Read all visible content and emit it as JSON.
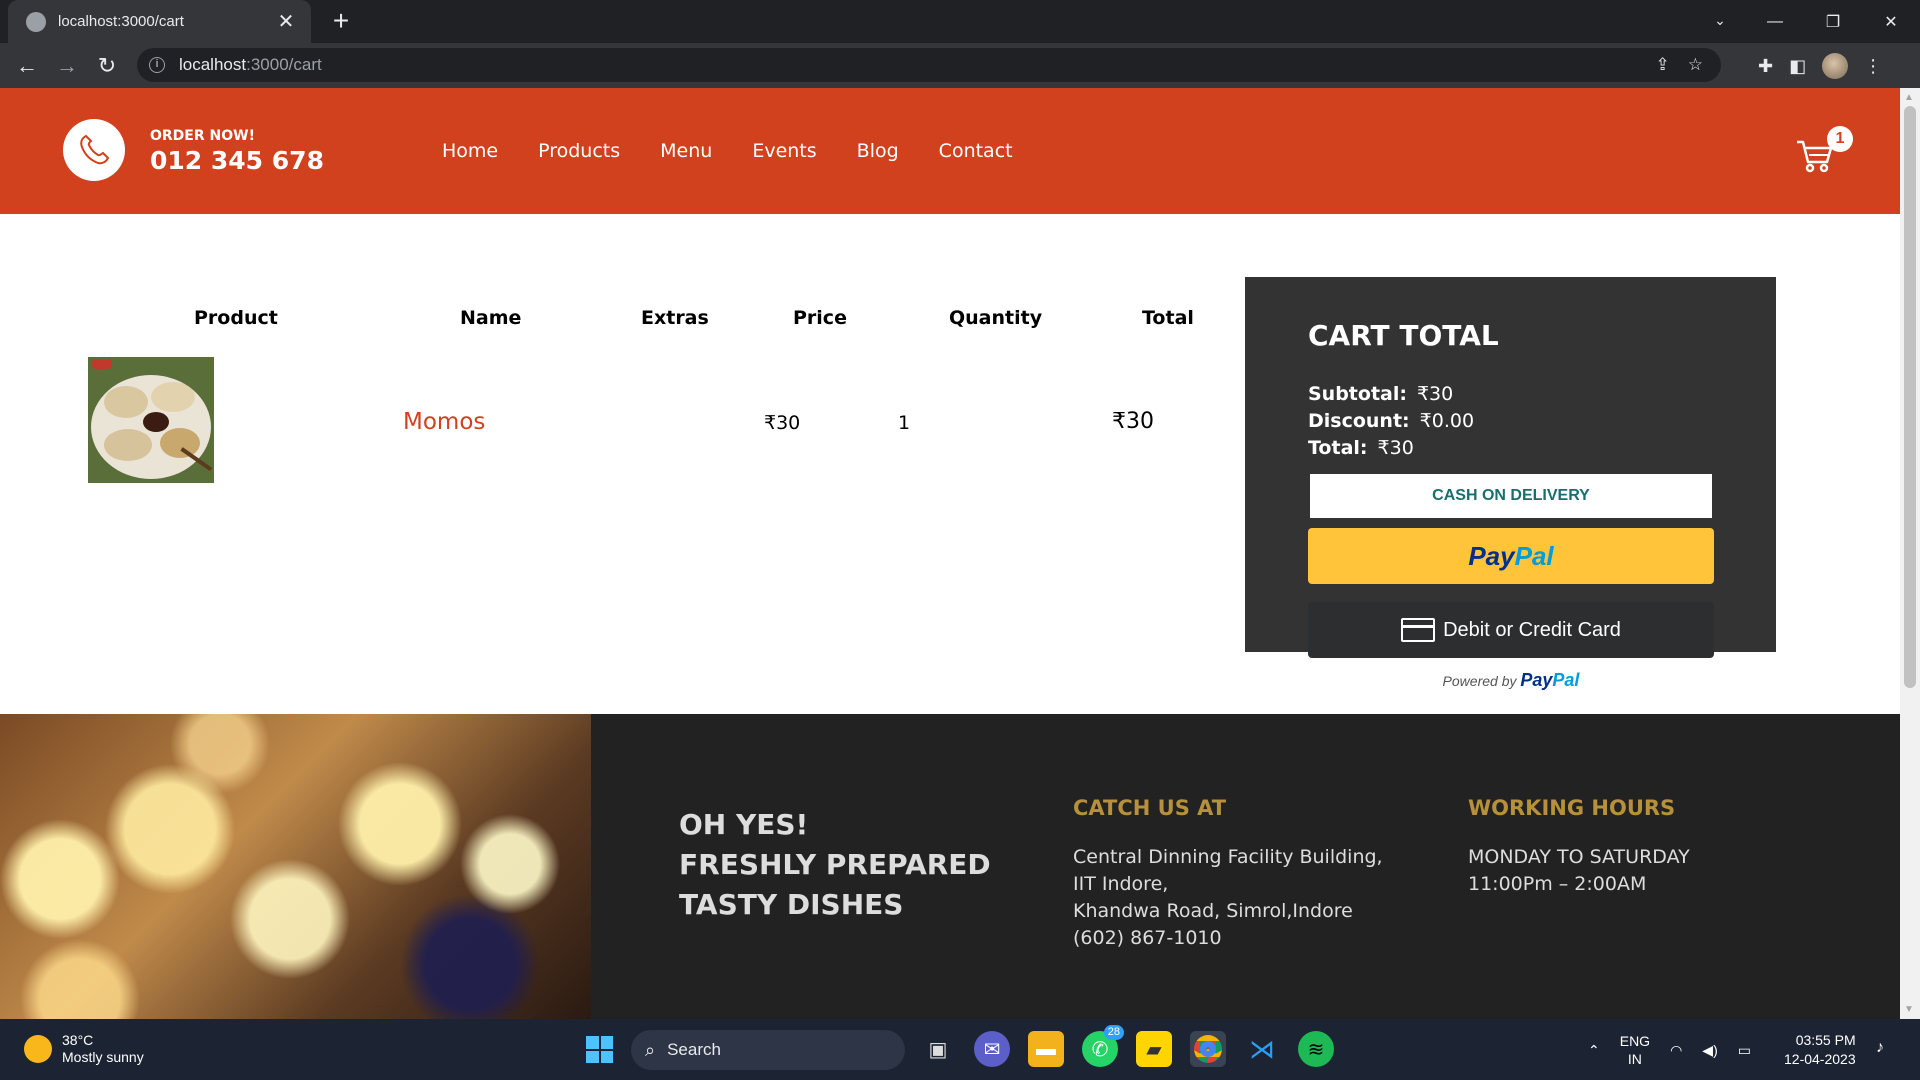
{
  "browser": {
    "tab_title": "localhost:3000/cart",
    "url_host": "localhost",
    "url_path": ":3000/cart"
  },
  "header": {
    "order_label": "ORDER NOW!",
    "phone": "012 345 678",
    "nav": [
      "Home",
      "Products",
      "Menu",
      "Events",
      "Blog",
      "Contact"
    ],
    "cart_count": "1",
    "brand_color": "#d1411e"
  },
  "cart": {
    "columns": [
      "Product",
      "Name",
      "Extras",
      "Price",
      "Quantity",
      "Total"
    ],
    "items": [
      {
        "image": "momos-photo",
        "name": "Momos",
        "extras": "",
        "price": "₹30",
        "quantity": "1",
        "total": "₹30"
      }
    ]
  },
  "totals": {
    "title": "CART TOTAL",
    "subtotal_label": "Subtotal:",
    "subtotal": "₹30",
    "discount_label": "Discount:",
    "discount": "₹0.00",
    "total_label": "Total:",
    "total": "₹30",
    "cod_label": "CASH ON DELIVERY",
    "paypal_pay": "Pay",
    "paypal_pal": "Pal",
    "card_label": "Debit or Credit Card",
    "powered_by": "Powered by"
  },
  "footer": {
    "slogan": [
      "OH YES!",
      "FRESHLY PREPARED",
      "TASTY DISHES"
    ],
    "catch_title": "CATCH US AT",
    "address": [
      "Central Dinning Facility Building,",
      "IIT Indore,",
      "Khandwa Road, Simrol,Indore",
      "(602) 867-1010"
    ],
    "hours_title": "WORKING HOURS",
    "hours": [
      "MONDAY TO SATURDAY",
      "11:00Pm – 2:00AM"
    ]
  },
  "taskbar": {
    "temperature": "38°C",
    "weather": "Mostly sunny",
    "search_label": "Search",
    "whatsapp_count": "28",
    "lang_top": "ENG",
    "lang_bottom": "IN",
    "time": "03:55 PM",
    "date": "12-04-2023"
  }
}
